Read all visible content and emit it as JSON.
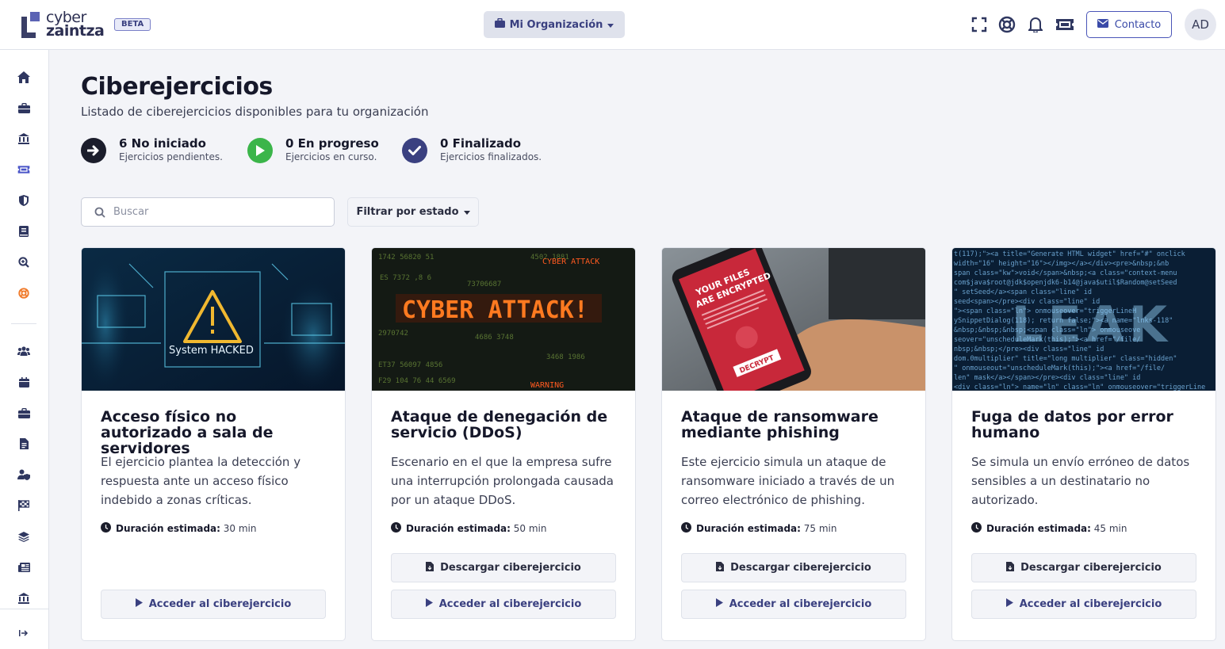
{
  "header": {
    "logo_line1": "cyber",
    "logo_line2": "zaintza",
    "beta": "BETA",
    "org_label": "Mi Organización",
    "contact_label": "Contacto",
    "avatar_initials": "AD",
    "icons": [
      "fullscreen-icon",
      "support-lifebuoy-icon",
      "bell-icon",
      "ticket-icon"
    ]
  },
  "sidebar": {
    "items": [
      {
        "icon": "home-icon",
        "active": false
      },
      {
        "icon": "briefcase-icon",
        "active": false
      },
      {
        "icon": "bank-icon",
        "active": false
      },
      {
        "icon": "ticket-icon",
        "active": true
      },
      {
        "icon": "shield-icon",
        "active": false
      },
      {
        "icon": "book-icon",
        "active": false
      },
      {
        "icon": "search-plus-icon",
        "active": false
      },
      {
        "icon": "lifebuoy-icon",
        "active": false,
        "accent": "#f07a2a"
      },
      {
        "icon": "users-icon",
        "active": false
      },
      {
        "icon": "calendar-icon",
        "active": false
      },
      {
        "icon": "briefcase-icon",
        "active": false
      },
      {
        "icon": "file-icon",
        "active": false
      },
      {
        "icon": "user-shield-icon",
        "active": false
      },
      {
        "icon": "flag-checkered-icon",
        "active": false
      },
      {
        "icon": "layers-icon",
        "active": false
      },
      {
        "icon": "newspaper-icon",
        "active": false
      },
      {
        "icon": "bank-icon",
        "active": false
      }
    ],
    "collapse_icon": "expand-arrow-icon"
  },
  "main": {
    "title": "Ciberejercicios",
    "subtitle": "Listado de ciberejercicios disponibles para tu organización",
    "stats": [
      {
        "title": "6 No iniciado",
        "desc": "Ejercicios pendientes.",
        "color": "#1b1d2b",
        "icon": "arrow-right-icon"
      },
      {
        "title": "0 En progreso",
        "desc": "Ejercicios en curso.",
        "color": "#3bb54a",
        "icon": "play-icon"
      },
      {
        "title": "0 Finalizado",
        "desc": "Ejercicios finalizados.",
        "color": "#3a4080",
        "icon": "check-icon"
      }
    ],
    "search_placeholder": "Buscar",
    "filter_label": "Filtrar por estado",
    "duration_label": "Duración estimada:",
    "download_label": "Descargar ciberejercicio",
    "access_label": "Acceder al ciberejercicio",
    "cards": [
      {
        "title": "Acceso físico no autorizado a sala de servidores",
        "desc": "El ejercicio plantea la detección y respuesta ante un acceso físico indebido a zonas críticas.",
        "duration": "30 min",
        "has_download": false,
        "image_text": "System HACKED"
      },
      {
        "title": "Ataque de denegación de servicio (DDoS)",
        "desc": "Escenario en el que la empresa sufre una interrupción prolongada causada por un ataque DDoS.",
        "duration": "50 min",
        "has_download": true,
        "image_text": "CYBER ATTACK!"
      },
      {
        "title": "Ataque de ransomware mediante phishing",
        "desc": "Este ejercicio simula un ataque de ransomware iniciado a través de un correo electrónico de phishing.",
        "duration": "75 min",
        "has_download": true,
        "image_text": "YOUR FILES ARE ENCRYPTED"
      },
      {
        "title": "Fuga de datos por error humano",
        "desc": "Se simula un envío erróneo de datos sensibles a un destinatario no autorizado.",
        "duration": "45 min",
        "has_download": true,
        "image_text": "LEAK"
      }
    ]
  },
  "colors": {
    "primary": "#3a4080",
    "accent_blue": "#4a55b8",
    "success": "#3bb54a",
    "background": "#f3f4f8"
  }
}
